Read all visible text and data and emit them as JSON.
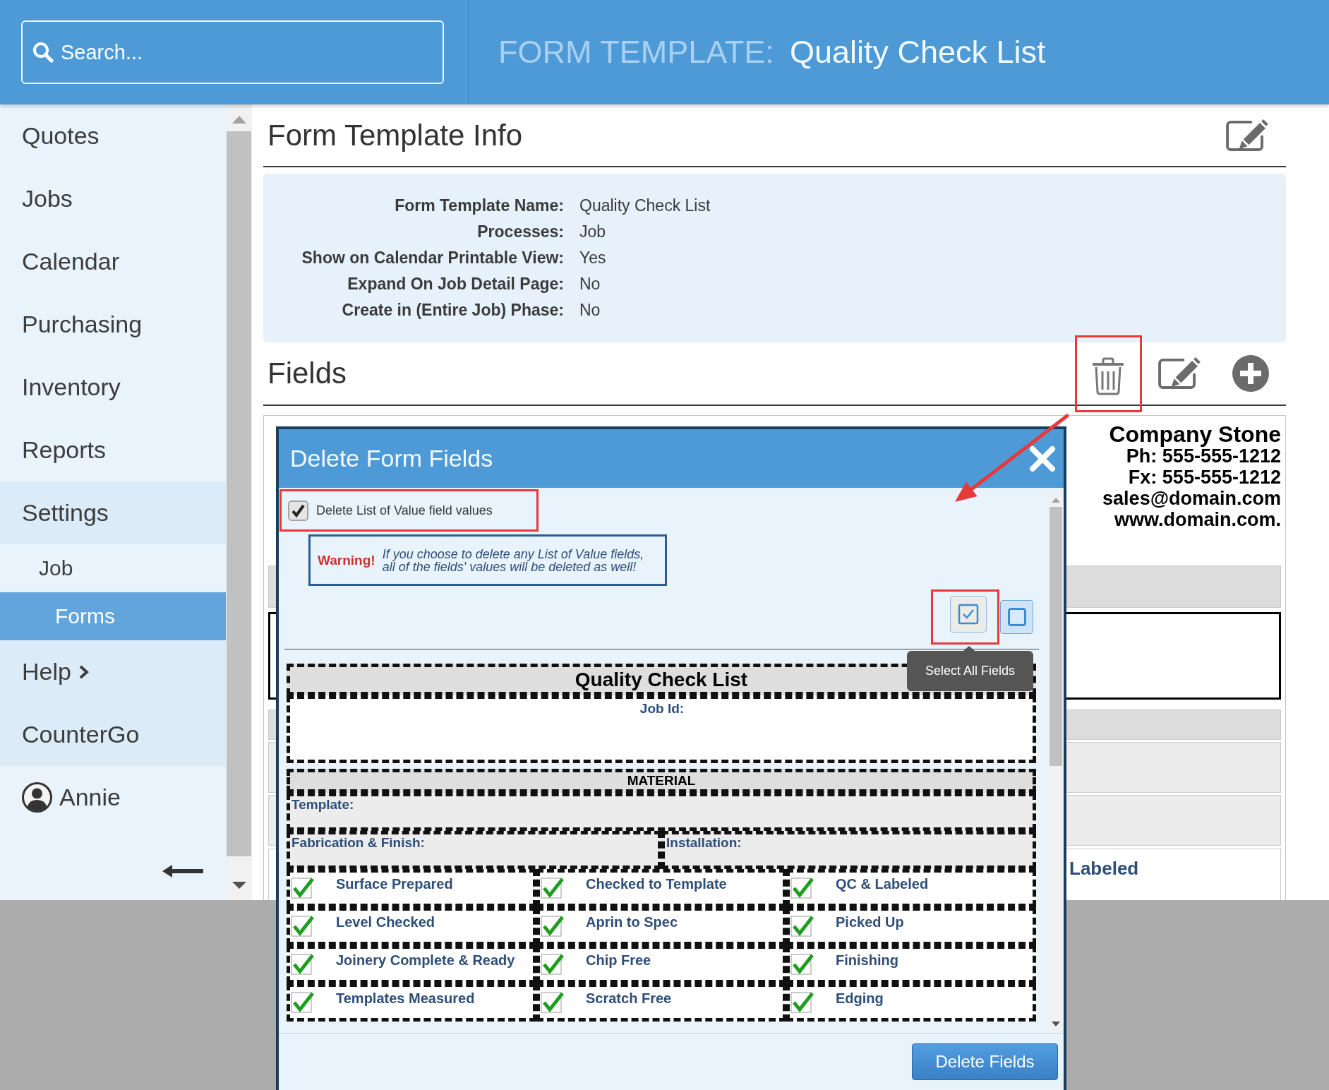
{
  "header": {
    "search": {
      "placeholder": "Search..."
    },
    "title_label": "FORM TEMPLATE:",
    "title": "Quality Check List"
  },
  "sidebar": {
    "items": [
      {
        "label": "Quotes",
        "kind": "link",
        "selected": false,
        "highlighted": false
      },
      {
        "label": "Jobs",
        "kind": "link",
        "selected": false,
        "highlighted": false
      },
      {
        "label": "Calendar",
        "kind": "link",
        "selected": false,
        "highlighted": false
      },
      {
        "label": "Purchasing",
        "kind": "link",
        "selected": false,
        "highlighted": false
      },
      {
        "label": "Inventory",
        "kind": "link",
        "selected": false,
        "highlighted": false
      },
      {
        "label": "Reports",
        "kind": "link",
        "selected": false,
        "highlighted": false
      },
      {
        "label": "Settings",
        "kind": "link",
        "selected": false,
        "highlighted": true,
        "children": [
          {
            "label": "Job",
            "kind": "link",
            "selected": false,
            "highlighted": false,
            "children": [
              {
                "label": "Forms",
                "kind": "link",
                "selected": true
              }
            ]
          }
        ]
      },
      {
        "label": "Help",
        "kind": "submenu",
        "selected": false,
        "highlighted": true
      },
      {
        "label": "CounterGo",
        "kind": "link",
        "selected": false,
        "highlighted": true
      },
      {
        "label": "Annie",
        "kind": "user",
        "selected": false,
        "highlighted": false
      }
    ]
  },
  "info_section": {
    "title": "Form Template Info",
    "rows": [
      {
        "label": "Form Template Name:",
        "value": "Quality Check List"
      },
      {
        "label": "Processes:",
        "value": "Job"
      },
      {
        "label": "Show on Calendar Printable View:",
        "value": "Yes"
      },
      {
        "label": "Expand On Job Detail Page:",
        "value": "No"
      },
      {
        "label": "Create in (Entire Job) Phase:",
        "value": "No"
      }
    ]
  },
  "fields_section": {
    "title": "Fields",
    "tools": [
      {
        "kind": "delete",
        "highlighted": true
      },
      {
        "kind": "edit",
        "highlighted": false
      },
      {
        "kind": "add",
        "highlighted": false
      }
    ]
  },
  "preview": {
    "company_lines": [
      "Company Stone",
      "Ph: 555-555-1212",
      "Fx: 555-555-1212",
      "sales@domain.com",
      "www.domain.com."
    ],
    "row_text": "Labeled"
  },
  "dialog": {
    "title": "Delete Form Fields",
    "option": {
      "label": "Delete List of Value field values",
      "checked": true,
      "highlighted": true
    },
    "warning": {
      "label": "Warning!",
      "text": "If you choose to delete any List of Value fields, all of the fields' values will be deleted as well!"
    },
    "select_buttons": [
      {
        "kind": "select_all",
        "highlighted": true,
        "tooltip": "Select All Fields"
      },
      {
        "kind": "select_none",
        "highlighted": false
      }
    ],
    "form": {
      "rows": [
        {
          "kind": "title",
          "label": "Quality Check List"
        },
        {
          "kind": "field",
          "label": "Job Id:"
        },
        {
          "kind": "section",
          "label": "MATERIAL"
        },
        {
          "kind": "note",
          "label": "Template:"
        },
        {
          "kind": "pair",
          "labels": [
            "Fabrication & Finish:",
            "Installation:"
          ]
        },
        {
          "kind": "checks",
          "cells": [
            {
              "kind": "check",
              "label": "Surface Prepared",
              "checked": true
            },
            {
              "kind": "check",
              "label": "Checked to Template",
              "checked": true
            },
            {
              "kind": "check",
              "label": "QC & Labeled",
              "checked": true
            }
          ]
        },
        {
          "kind": "checks",
          "cells": [
            {
              "kind": "check",
              "label": "Level Checked",
              "checked": true
            },
            {
              "kind": "check",
              "label": "Aprin to Spec",
              "checked": true
            },
            {
              "kind": "check",
              "label": "Picked Up",
              "checked": true
            }
          ]
        },
        {
          "kind": "checks",
          "cells": [
            {
              "kind": "check",
              "label": "Joinery Complete & Ready",
              "checked": true
            },
            {
              "kind": "check",
              "label": "Chip Free",
              "checked": true
            },
            {
              "kind": "check",
              "label": "Finishing",
              "checked": true
            }
          ]
        },
        {
          "kind": "checks",
          "cells": [
            {
              "kind": "check",
              "label": "Templates Measured",
              "checked": true
            },
            {
              "kind": "check",
              "label": "Scratch Free",
              "checked": true
            },
            {
              "kind": "check",
              "label": "Edging",
              "checked": true
            }
          ]
        }
      ]
    },
    "submit": "Delete Fields"
  }
}
